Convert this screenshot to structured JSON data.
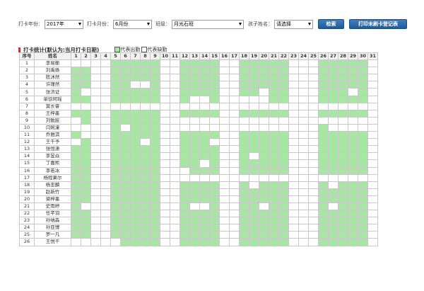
{
  "filters": {
    "year_label": "打卡年份：",
    "year_value": "2017年",
    "month_label": "打卡月份：",
    "month_value": "6月份",
    "class_label": "班级：",
    "class_value": "月光石班",
    "child_label": "孩子姓名：",
    "child_value": "请选择",
    "search_button": "检索",
    "print_button": "打印未刷卡登记表"
  },
  "stats": {
    "title": "打卡统计(默认为:当月打卡日期)",
    "legend_present": "代表出勤",
    "legend_absent": "代表缺勤"
  },
  "table": {
    "col_index": "序号",
    "col_name": "姓名",
    "days": [
      "1",
      "2",
      "3",
      "4",
      "5",
      "6",
      "7",
      "8",
      "9",
      "10",
      "11",
      "12",
      "13",
      "14",
      "15",
      "16",
      "17",
      "18",
      "19",
      "20",
      "21",
      "22",
      "23",
      "24",
      "25",
      "26",
      "27",
      "28",
      "29",
      "30",
      "31"
    ],
    "rows": [
      {
        "no": "1",
        "name": "李易衡",
        "att": [
          0,
          0,
          0,
          0,
          1,
          1,
          1,
          1,
          1,
          0,
          0,
          1,
          1,
          1,
          1,
          0,
          0,
          1,
          1,
          1,
          1,
          1,
          0,
          0,
          0,
          1,
          1,
          1,
          1,
          1,
          0
        ]
      },
      {
        "no": "2",
        "name": "刘禹扬",
        "att": [
          1,
          1,
          0,
          0,
          1,
          1,
          1,
          1,
          1,
          0,
          0,
          1,
          1,
          1,
          1,
          0,
          0,
          1,
          1,
          1,
          1,
          1,
          0,
          0,
          0,
          1,
          1,
          1,
          1,
          1,
          0
        ]
      },
      {
        "no": "3",
        "name": "陈沐然",
        "att": [
          1,
          1,
          0,
          0,
          1,
          1,
          1,
          1,
          1,
          0,
          0,
          1,
          1,
          1,
          1,
          0,
          0,
          1,
          1,
          1,
          1,
          1,
          0,
          0,
          0,
          1,
          1,
          1,
          1,
          1,
          0
        ]
      },
      {
        "no": "4",
        "name": "许瑾然",
        "att": [
          1,
          1,
          0,
          0,
          1,
          1,
          0,
          0,
          1,
          0,
          0,
          1,
          1,
          1,
          1,
          0,
          0,
          1,
          1,
          1,
          1,
          1,
          0,
          0,
          0,
          1,
          1,
          1,
          1,
          1,
          0
        ]
      },
      {
        "no": "5",
        "name": "张济证",
        "att": [
          1,
          0,
          0,
          0,
          1,
          1,
          1,
          1,
          1,
          0,
          0,
          1,
          1,
          1,
          1,
          0,
          0,
          1,
          1,
          0,
          1,
          1,
          0,
          0,
          0,
          1,
          1,
          1,
          0,
          1,
          0
        ]
      },
      {
        "no": "6",
        "name": "单徐珂瑶",
        "att": [
          1,
          1,
          0,
          0,
          1,
          1,
          1,
          1,
          1,
          0,
          0,
          1,
          0,
          0,
          1,
          0,
          0,
          0,
          0,
          0,
          1,
          1,
          0,
          0,
          0,
          1,
          1,
          1,
          1,
          1,
          0
        ]
      },
      {
        "no": "7",
        "name": "莫长睿",
        "att": [
          0,
          0,
          0,
          0,
          0,
          0,
          0,
          0,
          0,
          0,
          0,
          0,
          0,
          0,
          0,
          0,
          0,
          0,
          0,
          0,
          0,
          0,
          0,
          0,
          0,
          0,
          0,
          0,
          0,
          0,
          0
        ]
      },
      {
        "no": "8",
        "name": "王梓墨",
        "att": [
          1,
          1,
          0,
          0,
          1,
          1,
          1,
          1,
          1,
          0,
          0,
          1,
          1,
          1,
          1,
          0,
          0,
          1,
          1,
          1,
          1,
          1,
          0,
          0,
          0,
          1,
          1,
          1,
          1,
          1,
          0
        ]
      },
      {
        "no": "9",
        "name": "刘勉宸",
        "att": [
          0,
          1,
          0,
          0,
          1,
          1,
          1,
          1,
          1,
          0,
          0,
          0,
          0,
          0,
          0,
          0,
          0,
          0,
          0,
          0,
          0,
          0,
          0,
          0,
          0,
          0,
          0,
          0,
          0,
          0,
          0
        ]
      },
      {
        "no": "10",
        "name": "闫婉潼",
        "att": [
          0,
          0,
          0,
          0,
          1,
          0,
          1,
          1,
          1,
          0,
          0,
          0,
          0,
          0,
          0,
          0,
          0,
          0,
          0,
          0,
          0,
          0,
          0,
          0,
          0,
          1,
          0,
          0,
          0,
          0,
          0
        ]
      },
      {
        "no": "11",
        "name": "乔雅淇",
        "att": [
          1,
          0,
          0,
          0,
          1,
          1,
          1,
          1,
          1,
          0,
          0,
          1,
          1,
          1,
          1,
          0,
          0,
          1,
          1,
          1,
          1,
          1,
          0,
          0,
          0,
          1,
          1,
          1,
          1,
          1,
          0
        ]
      },
      {
        "no": "12",
        "name": "王千予",
        "att": [
          0,
          1,
          0,
          0,
          1,
          1,
          1,
          0,
          1,
          0,
          0,
          1,
          1,
          1,
          0,
          0,
          0,
          1,
          1,
          1,
          1,
          1,
          0,
          0,
          0,
          1,
          1,
          1,
          1,
          1,
          0
        ]
      },
      {
        "no": "13",
        "name": "张恒潇",
        "att": [
          1,
          1,
          0,
          0,
          1,
          1,
          1,
          1,
          1,
          0,
          0,
          1,
          1,
          1,
          1,
          0,
          0,
          1,
          1,
          1,
          1,
          1,
          0,
          0,
          0,
          1,
          1,
          1,
          1,
          1,
          0
        ]
      },
      {
        "no": "14",
        "name": "李昱焱",
        "att": [
          1,
          1,
          0,
          0,
          1,
          1,
          1,
          1,
          1,
          0,
          0,
          1,
          1,
          1,
          1,
          0,
          0,
          1,
          0,
          1,
          1,
          1,
          0,
          0,
          0,
          1,
          1,
          1,
          1,
          1,
          0
        ]
      },
      {
        "no": "15",
        "name": "丁嘉熙",
        "att": [
          1,
          1,
          0,
          0,
          1,
          1,
          1,
          1,
          1,
          0,
          0,
          1,
          1,
          0,
          1,
          0,
          0,
          1,
          1,
          1,
          1,
          1,
          0,
          0,
          0,
          1,
          1,
          1,
          1,
          1,
          0
        ]
      },
      {
        "no": "16",
        "name": "李若冰",
        "att": [
          1,
          1,
          0,
          0,
          1,
          1,
          1,
          1,
          1,
          0,
          0,
          0,
          1,
          1,
          1,
          0,
          0,
          1,
          1,
          1,
          1,
          1,
          0,
          0,
          0,
          1,
          1,
          1,
          1,
          1,
          0
        ]
      },
      {
        "no": "17",
        "name": "杨程果尔",
        "att": [
          1,
          1,
          0,
          0,
          1,
          1,
          1,
          1,
          1,
          0,
          0,
          0,
          0,
          0,
          0,
          0,
          0,
          0,
          0,
          0,
          0,
          0,
          0,
          0,
          0,
          0,
          0,
          0,
          0,
          0,
          0
        ]
      },
      {
        "no": "18",
        "name": "杨忠麟",
        "att": [
          1,
          1,
          0,
          0,
          1,
          1,
          1,
          1,
          1,
          0,
          0,
          1,
          1,
          1,
          1,
          0,
          0,
          1,
          0,
          1,
          1,
          1,
          0,
          0,
          0,
          1,
          0,
          1,
          1,
          1,
          0
        ]
      },
      {
        "no": "19",
        "name": "赵新竹",
        "att": [
          1,
          1,
          0,
          0,
          1,
          1,
          1,
          1,
          1,
          0,
          0,
          1,
          1,
          1,
          1,
          0,
          0,
          1,
          1,
          1,
          1,
          1,
          0,
          0,
          0,
          1,
          1,
          1,
          1,
          1,
          0
        ]
      },
      {
        "no": "20",
        "name": "梁梓墨",
        "att": [
          1,
          1,
          0,
          0,
          1,
          1,
          1,
          1,
          1,
          0,
          0,
          1,
          1,
          1,
          1,
          0,
          0,
          1,
          1,
          1,
          1,
          1,
          0,
          0,
          0,
          1,
          1,
          1,
          1,
          1,
          0
        ]
      },
      {
        "no": "21",
        "name": "史雨婷",
        "att": [
          1,
          0,
          0,
          0,
          1,
          1,
          1,
          1,
          1,
          0,
          0,
          1,
          0,
          0,
          1,
          0,
          0,
          1,
          1,
          0,
          1,
          1,
          0,
          0,
          0,
          1,
          0,
          1,
          1,
          1,
          0
        ]
      },
      {
        "no": "22",
        "name": "任芊羽",
        "att": [
          1,
          1,
          0,
          0,
          1,
          1,
          1,
          1,
          1,
          0,
          0,
          1,
          1,
          1,
          1,
          0,
          0,
          1,
          1,
          1,
          1,
          1,
          0,
          0,
          0,
          1,
          1,
          1,
          1,
          1,
          0
        ]
      },
      {
        "no": "23",
        "name": "孙纳森",
        "att": [
          1,
          1,
          0,
          0,
          1,
          1,
          1,
          1,
          1,
          0,
          0,
          1,
          1,
          1,
          1,
          0,
          0,
          1,
          1,
          1,
          1,
          1,
          0,
          0,
          0,
          1,
          1,
          1,
          1,
          1,
          0
        ]
      },
      {
        "no": "24",
        "name": "孙亚博",
        "att": [
          1,
          1,
          0,
          0,
          1,
          1,
          1,
          1,
          1,
          0,
          0,
          1,
          1,
          1,
          1,
          0,
          0,
          1,
          1,
          1,
          1,
          1,
          0,
          0,
          0,
          1,
          1,
          1,
          1,
          1,
          0
        ]
      },
      {
        "no": "25",
        "name": "罗一凡",
        "att": [
          1,
          1,
          0,
          0,
          1,
          1,
          1,
          1,
          1,
          0,
          0,
          1,
          1,
          1,
          1,
          0,
          0,
          1,
          1,
          1,
          1,
          1,
          0,
          0,
          0,
          1,
          1,
          1,
          1,
          1,
          0
        ]
      },
      {
        "no": "26",
        "name": "王悦千",
        "att": [
          0,
          0,
          0,
          0,
          0,
          1,
          1,
          1,
          1,
          0,
          0,
          1,
          1,
          1,
          1,
          0,
          0,
          1,
          1,
          1,
          1,
          1,
          0,
          0,
          0,
          1,
          1,
          1,
          1,
          1,
          0
        ]
      }
    ]
  },
  "colors": {
    "present": "#a8e6a3",
    "absent": "#ffffff",
    "accent": "#1f5a98"
  }
}
